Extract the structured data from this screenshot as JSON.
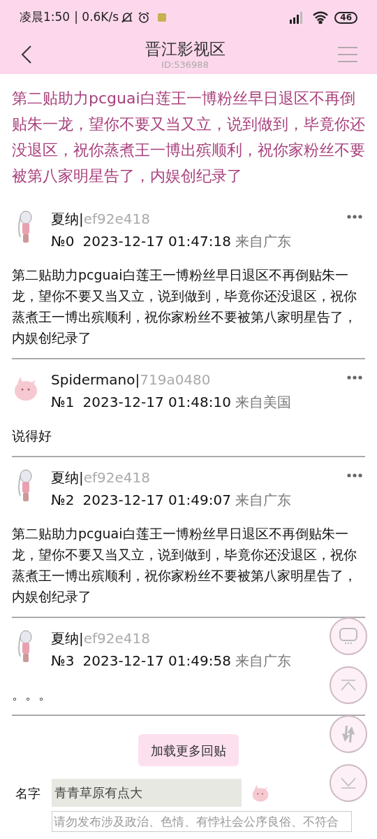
{
  "status_bar": {
    "time": "凌晨1:50",
    "speed": "| 0.6K/s",
    "battery": "46"
  },
  "header": {
    "title": "晋江影视区",
    "id": "ID:536988"
  },
  "thread_title": "第二贴助力pcguai白莲王一博粉丝早日退区不再倒贴朱一龙，望你不要又当又立，说到做到，毕竟你还没退区，祝你蒸煮王一博出殡顺利，祝你家粉丝不要被第八家明星告了，内娱创纪录了",
  "posts": [
    {
      "kind": "figure",
      "name": "夏纳|",
      "user_id": "ef92e418",
      "floor": "№0",
      "more_button": true,
      "time": "2023-12-17 01:47:18",
      "location": "来自广东",
      "content": "第二贴助力pcguai白莲王一博粉丝早日退区不再倒贴朱一龙，望你不要又当又立，说到做到，毕竟你还没退区，祝你蒸煮王一博出殡顺利，祝你家粉丝不要被第八家明星告了，内娱创纪录了"
    },
    {
      "kind": "creature",
      "name": "Spidermano|",
      "user_id": "719a0480",
      "floor": "№1",
      "more_button": true,
      "time": "2023-12-17 01:48:10",
      "location": "来自美国",
      "content": "说得好"
    },
    {
      "kind": "figure",
      "name": "夏纳|",
      "user_id": "ef92e418",
      "floor": "№2",
      "more_button": true,
      "time": "2023-12-17 01:49:07",
      "location": "来自广东",
      "content": "第二贴助力pcguai白莲王一博粉丝早日退区不再倒贴朱一龙，望你不要又当又立，说到做到，毕竟你还没退区，祝你蒸煮王一博出殡顺利，祝你家粉丝不要被第八家明星告了，内娱创纪录了"
    },
    {
      "kind": "figure",
      "name": "夏纳|",
      "user_id": "ef92e418",
      "floor": "№3",
      "more_button": false,
      "time": "2023-12-17 01:49:58",
      "location": "来自广东",
      "content": "。。。"
    }
  ],
  "load_more": "加载更多回贴",
  "form": {
    "name_label": "名字",
    "name_value": "青青草原有点大",
    "content_placeholder": "请勿发布涉及政治、色情、有悖社会公序良俗、不符合"
  }
}
